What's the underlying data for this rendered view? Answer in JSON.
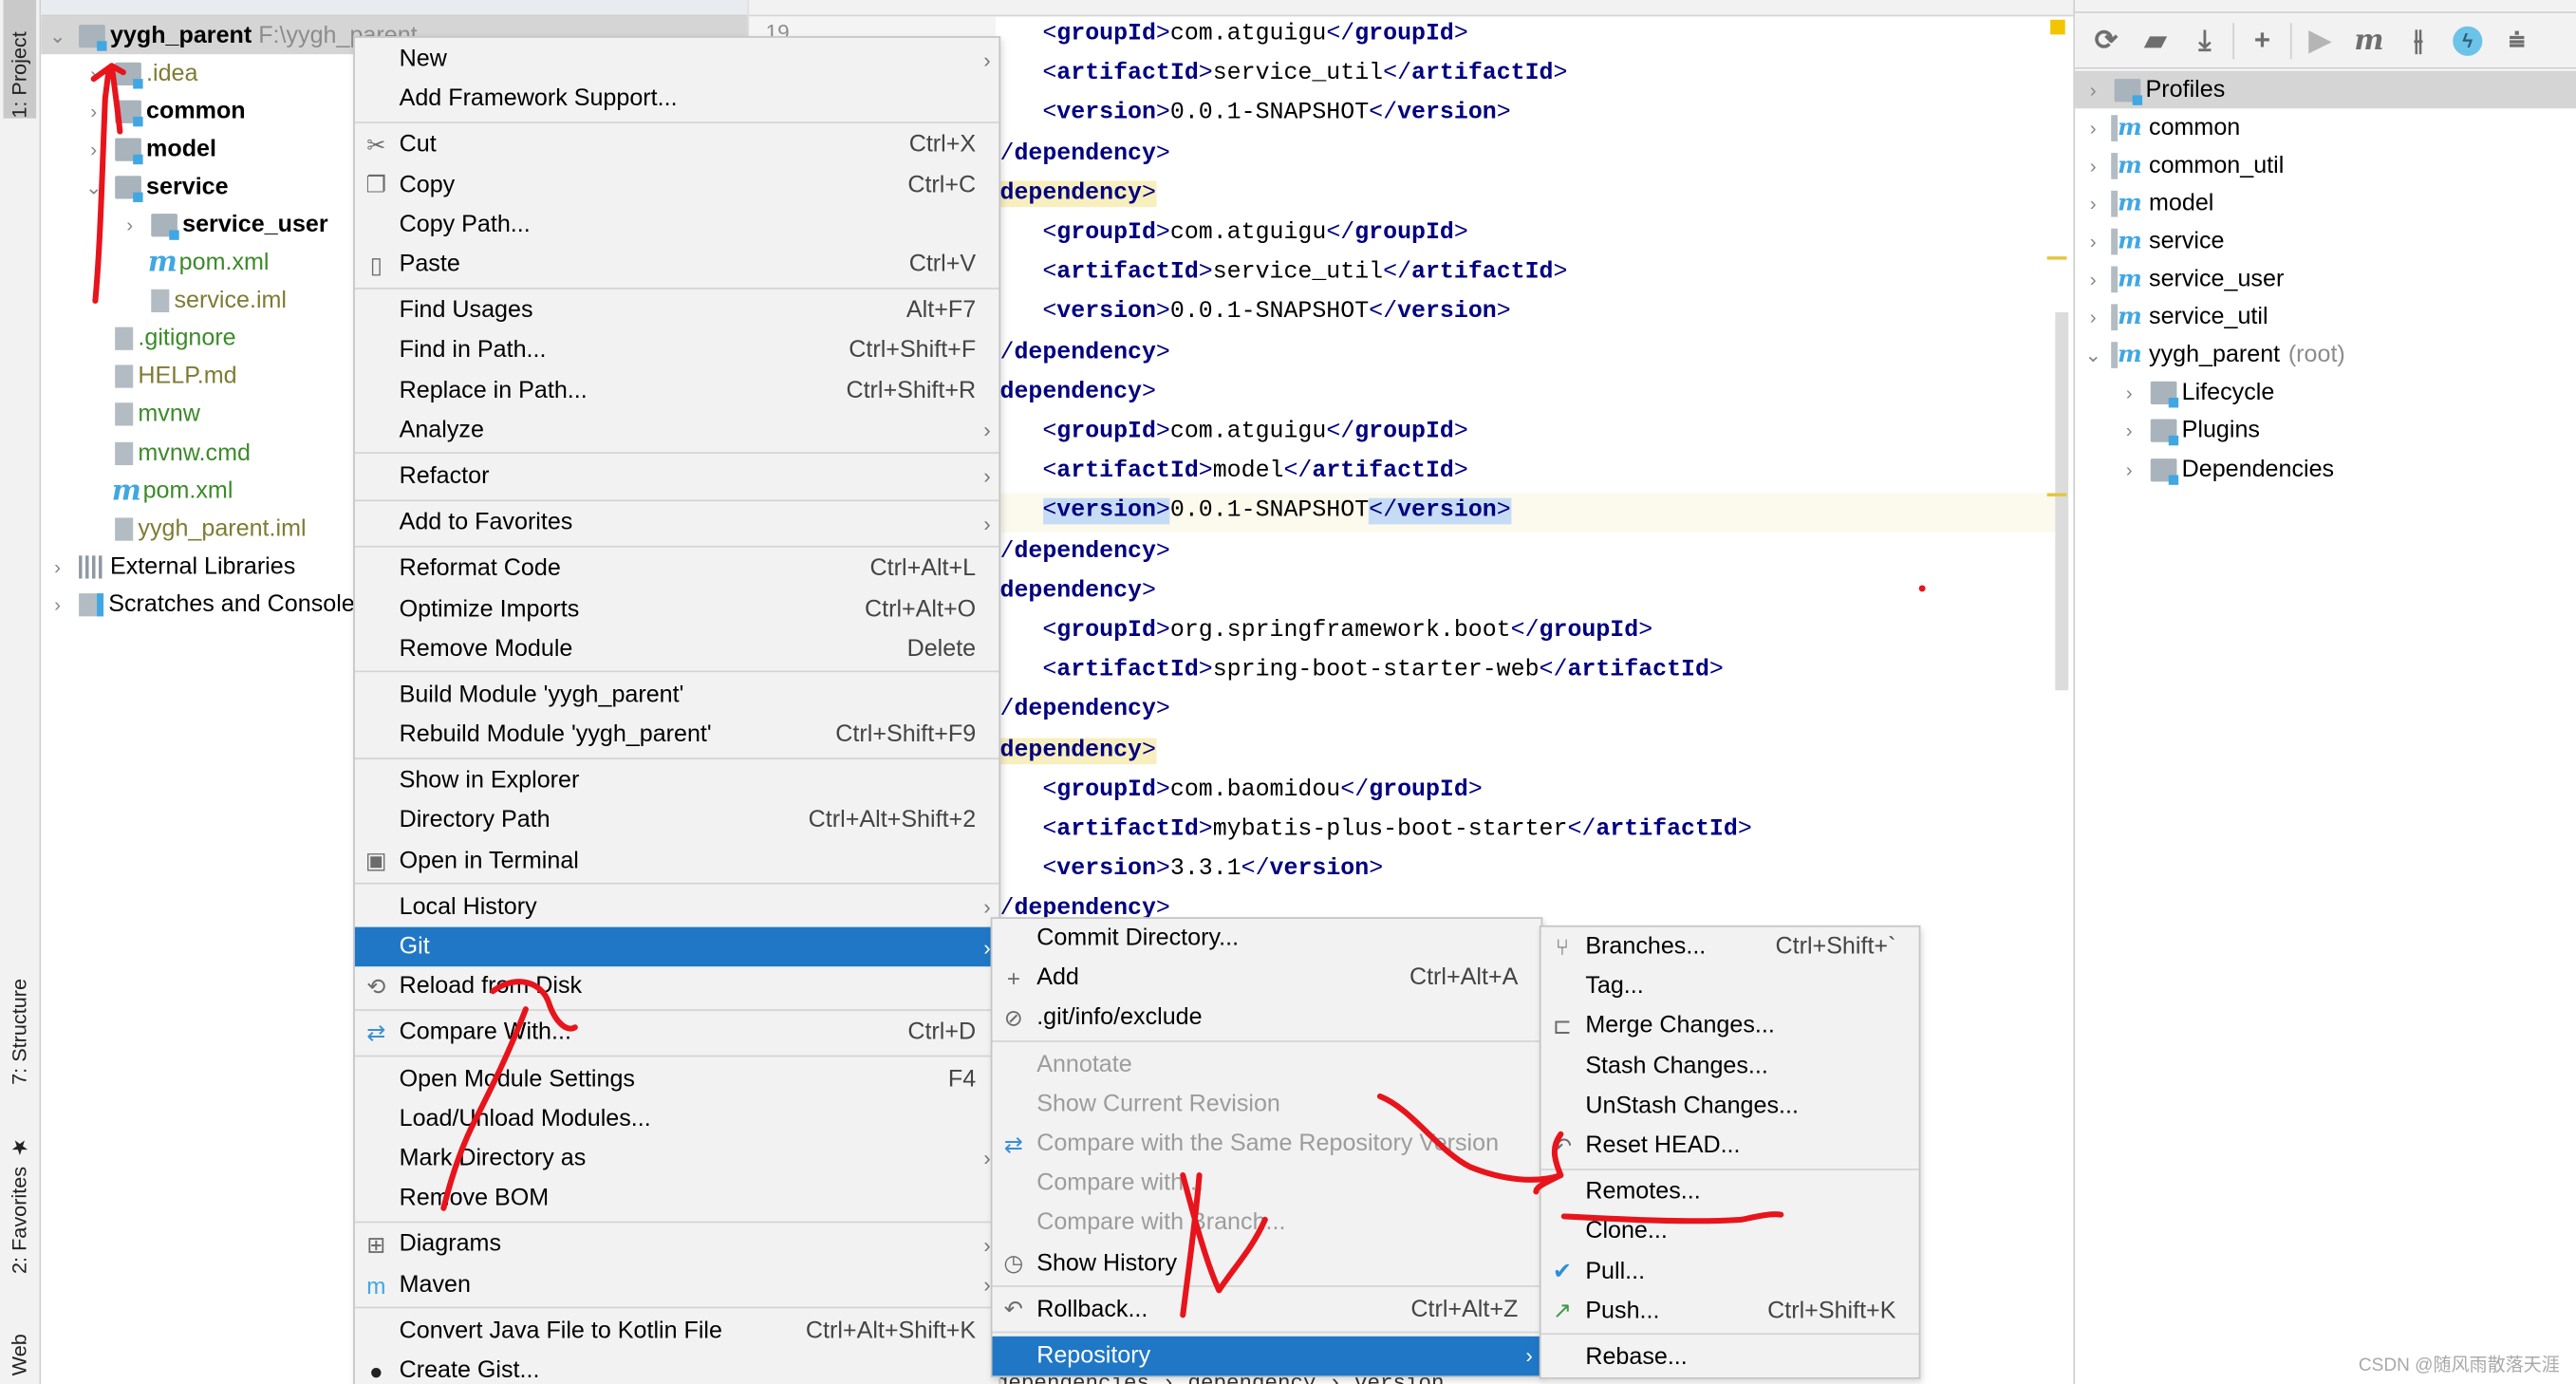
{
  "left_toolbar": {
    "project_tab": "1: Project",
    "structure_tab": "7: Structure",
    "favorites_tab": "2: Favorites",
    "web_tab": "Web"
  },
  "project_tree": {
    "root": {
      "label": "yygh_parent",
      "path": "F:\\yygh_parent"
    },
    "items": [
      {
        "label": ".idea",
        "indent": 1,
        "kind": "folder",
        "color": "olive",
        "chevron": "right"
      },
      {
        "label": "common",
        "indent": 1,
        "kind": "module",
        "color": "bold",
        "chevron": "right"
      },
      {
        "label": "model",
        "indent": 1,
        "kind": "module",
        "color": "bold",
        "chevron": "right"
      },
      {
        "label": "service",
        "indent": 1,
        "kind": "module",
        "color": "bold",
        "chevron": "down"
      },
      {
        "label": "service_user",
        "indent": 2,
        "kind": "module",
        "color": "bold",
        "chevron": "right"
      },
      {
        "label": "pom.xml",
        "indent": 2,
        "kind": "maven",
        "color": "green",
        "chevron": ""
      },
      {
        "label": "service.iml",
        "indent": 2,
        "kind": "file",
        "color": "olive",
        "chevron": ""
      },
      {
        "label": ".gitignore",
        "indent": 1,
        "kind": "file",
        "color": "green",
        "chevron": ""
      },
      {
        "label": "HELP.md",
        "indent": 1,
        "kind": "file",
        "color": "olive",
        "chevron": ""
      },
      {
        "label": "mvnw",
        "indent": 1,
        "kind": "file",
        "color": "green",
        "chevron": ""
      },
      {
        "label": "mvnw.cmd",
        "indent": 1,
        "kind": "file",
        "color": "green",
        "chevron": ""
      },
      {
        "label": "pom.xml",
        "indent": 1,
        "kind": "maven",
        "color": "green",
        "chevron": ""
      },
      {
        "label": "yygh_parent.iml",
        "indent": 1,
        "kind": "file",
        "color": "olive",
        "chevron": ""
      },
      {
        "label": "External Libraries",
        "indent": 0,
        "kind": "library",
        "color": "",
        "chevron": "right"
      },
      {
        "label": "Scratches and Consoles",
        "indent": 0,
        "kind": "scratch",
        "color": "",
        "chevron": "right"
      }
    ]
  },
  "editor": {
    "top_line_number": "19",
    "lines": [
      {
        "text": "    <groupId>com.atguigu</groupId>"
      },
      {
        "text": "    <artifactId>service_util</artifactId>"
      },
      {
        "text": "    <version>0.0.1-SNAPSHOT</version>"
      },
      {
        "text": "</dependency>"
      },
      {
        "text": "<dependency>",
        "highlight": "tag"
      },
      {
        "text": "    <groupId>com.atguigu</groupId>"
      },
      {
        "text": "    <artifactId>service_util</artifactId>"
      },
      {
        "text": "    <version>0.0.1-SNAPSHOT</version>"
      },
      {
        "text": "</dependency>"
      },
      {
        "text": "<dependency>"
      },
      {
        "text": "    <groupId>com.atguigu</groupId>"
      },
      {
        "text": "    <artifactId>model</artifactId>"
      },
      {
        "text": "    <version>0.0.1-SNAPSHOT</version>",
        "highlight": "pair"
      },
      {
        "text": "</dependency>"
      },
      {
        "text": "<dependency>"
      },
      {
        "text": "    <groupId>org.springframework.boot</groupId>"
      },
      {
        "text": "    <artifactId>spring-boot-starter-web</artifactId>"
      },
      {
        "text": "</dependency>"
      },
      {
        "text": "<dependency>",
        "highlight": "tag"
      },
      {
        "text": "    <groupId>com.baomidou</groupId>"
      },
      {
        "text": "    <artifactId>mybatis-plus-boot-starter</artifactId>"
      },
      {
        "text": "    <version>3.3.1</version>"
      },
      {
        "text": "</dependency>"
      }
    ],
    "breadcrumb": "dependencies  ›  dependency  ›  version"
  },
  "context_menu": {
    "groups": [
      [
        {
          "label": "New",
          "submenu": true
        },
        {
          "label": "Add Framework Support..."
        }
      ],
      [
        {
          "label": "Cut",
          "shortcut": "Ctrl+X",
          "icon": "cut-icon"
        },
        {
          "label": "Copy",
          "shortcut": "Ctrl+C",
          "icon": "copy-icon"
        },
        {
          "label": "Copy Path..."
        },
        {
          "label": "Paste",
          "shortcut": "Ctrl+V",
          "icon": "paste-icon"
        }
      ],
      [
        {
          "label": "Find Usages",
          "shortcut": "Alt+F7"
        },
        {
          "label": "Find in Path...",
          "shortcut": "Ctrl+Shift+F"
        },
        {
          "label": "Replace in Path...",
          "shortcut": "Ctrl+Shift+R"
        },
        {
          "label": "Analyze",
          "submenu": true
        }
      ],
      [
        {
          "label": "Refactor",
          "submenu": true
        }
      ],
      [
        {
          "label": "Add to Favorites",
          "submenu": true
        }
      ],
      [
        {
          "label": "Reformat Code",
          "shortcut": "Ctrl+Alt+L"
        },
        {
          "label": "Optimize Imports",
          "shortcut": "Ctrl+Alt+O"
        },
        {
          "label": "Remove Module",
          "shortcut": "Delete"
        }
      ],
      [
        {
          "label": "Build Module 'yygh_parent'"
        },
        {
          "label": "Rebuild Module 'yygh_parent'",
          "shortcut": "Ctrl+Shift+F9"
        }
      ],
      [
        {
          "label": "Show in Explorer"
        },
        {
          "label": "Directory Path",
          "shortcut": "Ctrl+Alt+Shift+2"
        },
        {
          "label": "Open in Terminal",
          "icon": "terminal-icon"
        }
      ],
      [
        {
          "label": "Local History",
          "submenu": true
        },
        {
          "label": "Git",
          "submenu": true,
          "selected": true
        },
        {
          "label": "Reload from Disk",
          "icon": "reload-icon"
        }
      ],
      [
        {
          "label": "Compare With...",
          "shortcut": "Ctrl+D",
          "icon": "compare-icon"
        }
      ],
      [
        {
          "label": "Open Module Settings",
          "shortcut": "F4"
        },
        {
          "label": "Load/Unload Modules..."
        },
        {
          "label": "Mark Directory as",
          "submenu": true
        },
        {
          "label": "Remove BOM"
        }
      ],
      [
        {
          "label": "Diagrams",
          "submenu": true,
          "icon": "diagram-icon"
        },
        {
          "label": "Maven",
          "submenu": true,
          "icon": "maven-icon"
        }
      ],
      [
        {
          "label": "Convert Java File to Kotlin File",
          "shortcut": "Ctrl+Alt+Shift+K"
        },
        {
          "label": "Create Gist...",
          "icon": "github-icon"
        }
      ]
    ]
  },
  "git_menu": {
    "groups": [
      [
        {
          "label": "Commit Directory..."
        },
        {
          "label": "Add",
          "shortcut": "Ctrl+Alt+A",
          "icon": "plus-icon"
        },
        {
          "label": ".git/info/exclude",
          "icon": "ignore-file-icon"
        }
      ],
      [
        {
          "label": "Annotate",
          "disabled": true
        },
        {
          "label": "Show Current Revision",
          "disabled": true
        },
        {
          "label": "Compare with the Same Repository Version",
          "disabled": true,
          "icon": "compare-icon"
        },
        {
          "label": "Compare with...",
          "disabled": true
        },
        {
          "label": "Compare with Branch...",
          "disabled": true
        },
        {
          "label": "Show History",
          "icon": "clock-icon"
        }
      ],
      [
        {
          "label": "Rollback...",
          "shortcut": "Ctrl+Alt+Z",
          "icon": "rollback-icon"
        }
      ],
      [
        {
          "label": "Repository",
          "submenu": true,
          "selected": true
        }
      ]
    ]
  },
  "repository_menu": {
    "groups": [
      [
        {
          "label": "Branches...",
          "shortcut": "Ctrl+Shift+`",
          "icon": "branch-icon"
        },
        {
          "label": "Tag..."
        },
        {
          "label": "Merge Changes...",
          "icon": "merge-icon"
        },
        {
          "label": "Stash Changes..."
        },
        {
          "label": "UnStash Changes..."
        },
        {
          "label": "Reset HEAD...",
          "icon": "undo-icon"
        }
      ],
      [
        {
          "label": "Remotes..."
        },
        {
          "label": "Clone..."
        },
        {
          "label": "Pull...",
          "icon": "pull-icon"
        },
        {
          "label": "Push...",
          "shortcut": "Ctrl+Shift+K",
          "icon": "push-icon"
        }
      ],
      [
        {
          "label": "Rebase..."
        }
      ]
    ]
  },
  "maven_panel": {
    "toolbar": [
      "refresh-icon",
      "reimport-folder-icon",
      "download-icon",
      "add-icon",
      "run-icon",
      "maven-goal-icon",
      "skip-tests-icon",
      "offline-icon",
      "collapse-icon"
    ],
    "items": [
      {
        "label": "Profiles",
        "indent": 0,
        "chevron": "right",
        "kind": "profiles",
        "selected": true
      },
      {
        "label": "common",
        "indent": 0,
        "chevron": "right",
        "kind": "module"
      },
      {
        "label": "common_util",
        "indent": 0,
        "chevron": "right",
        "kind": "module"
      },
      {
        "label": "model",
        "indent": 0,
        "chevron": "right",
        "kind": "module"
      },
      {
        "label": "service",
        "indent": 0,
        "chevron": "right",
        "kind": "module"
      },
      {
        "label": "service_user",
        "indent": 0,
        "chevron": "right",
        "kind": "module"
      },
      {
        "label": "service_util",
        "indent": 0,
        "chevron": "right",
        "kind": "module"
      },
      {
        "label": "yygh_parent",
        "suffix": "(root)",
        "indent": 0,
        "chevron": "down",
        "kind": "module"
      },
      {
        "label": "Lifecycle",
        "indent": 1,
        "chevron": "right",
        "kind": "gear-folder"
      },
      {
        "label": "Plugins",
        "indent": 1,
        "chevron": "right",
        "kind": "gear-folder"
      },
      {
        "label": "Dependencies",
        "indent": 1,
        "chevron": "right",
        "kind": "deps"
      }
    ]
  },
  "watermark": "CSDN @随风雨散落天涯",
  "colors": {
    "selection": "#1f77c5",
    "annotation": "#e8141c",
    "tag": "#000080",
    "vcs_added": "#3c8a2a",
    "vcs_ignored": "#7f7b33"
  }
}
